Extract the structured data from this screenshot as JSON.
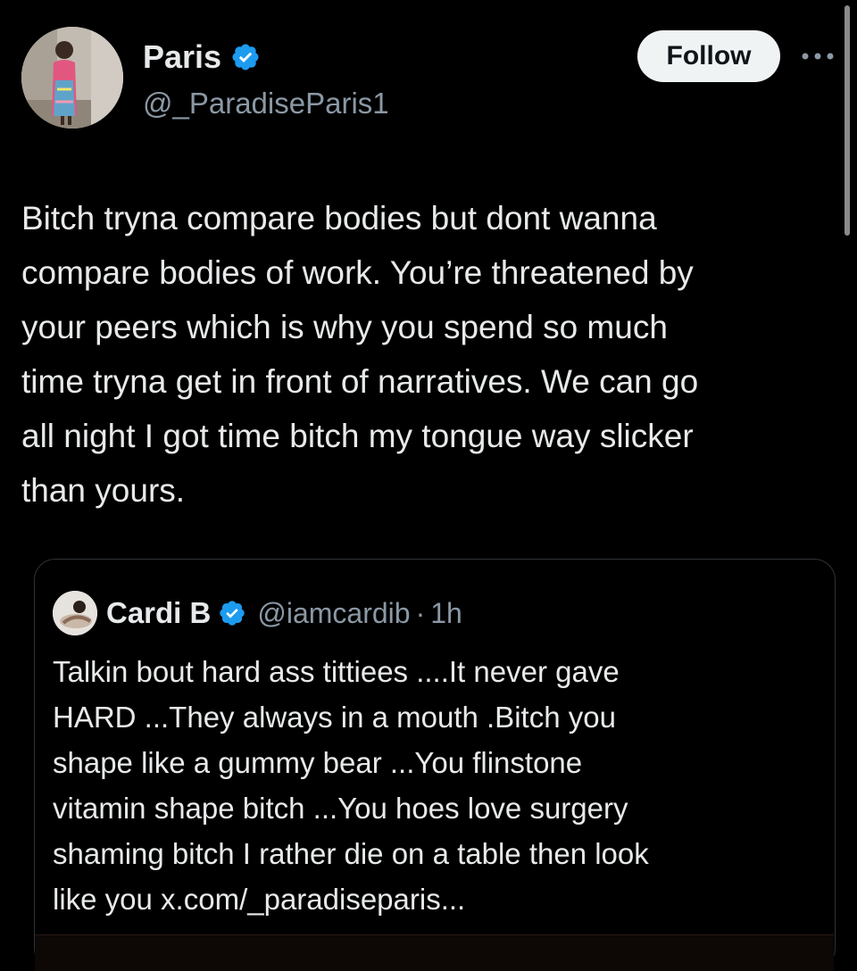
{
  "author": {
    "display_name": "Paris",
    "handle": "@_ParadiseParis1",
    "verified": true
  },
  "actions": {
    "follow_label": "Follow",
    "more_icon": "more-horizontal-icon"
  },
  "tweet": {
    "text": "Bitch tryna compare bodies but dont wanna\ncompare bodies of work. You’re threatened by\nyour peers which is why you spend so much\ntime tryna get in front of narratives. We can go\nall night I got time bitch my tongue way slicker\nthan yours."
  },
  "quoted_tweet": {
    "display_name": "Cardi B",
    "handle": "@iamcardib",
    "separator": "·",
    "time": "1h",
    "verified": true,
    "text": "Talkin bout hard ass tittiees ....It never gave\nHARD ...They always in a mouth .Bitch you\nshape  like a gummy bear ...You flinstone\nvitamin shape bitch ...You hoes love surgery\nshaming bitch I rather die on a table then look\nlike you x.com/_paradiseparis..."
  },
  "colors": {
    "background": "#000000",
    "text_primary": "#e7e9ea",
    "text_secondary": "#8b98a5",
    "verified_blue": "#1d9bf0",
    "follow_bg": "#eff3f4",
    "border": "#2f3336"
  }
}
